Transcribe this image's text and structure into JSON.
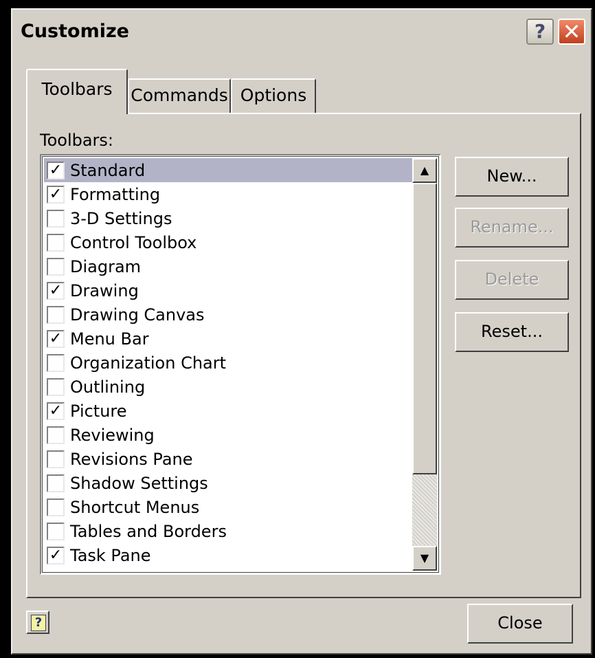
{
  "window": {
    "title": "Customize",
    "help_glyph": "?",
    "close_glyph": "✕"
  },
  "tabs": [
    {
      "label": "Toolbars",
      "active": true
    },
    {
      "label": "Commands",
      "active": false
    },
    {
      "label": "Options",
      "active": false
    }
  ],
  "toolbars_panel": {
    "label": "Toolbars:",
    "items": [
      {
        "label": "Standard",
        "checked": true,
        "selected": true
      },
      {
        "label": "Formatting",
        "checked": true
      },
      {
        "label": "3-D Settings",
        "checked": false
      },
      {
        "label": "Control Toolbox",
        "checked": false
      },
      {
        "label": "Diagram",
        "checked": false
      },
      {
        "label": "Drawing",
        "checked": true
      },
      {
        "label": "Drawing Canvas",
        "checked": false
      },
      {
        "label": "Menu Bar",
        "checked": true
      },
      {
        "label": "Organization Chart",
        "checked": false
      },
      {
        "label": "Outlining",
        "checked": false
      },
      {
        "label": "Picture",
        "checked": true
      },
      {
        "label": "Reviewing",
        "checked": false
      },
      {
        "label": "Revisions Pane",
        "checked": false
      },
      {
        "label": "Shadow Settings",
        "checked": false
      },
      {
        "label": "Shortcut Menus",
        "checked": false
      },
      {
        "label": "Tables and Borders",
        "checked": false
      },
      {
        "label": "Task Pane",
        "checked": true
      }
    ],
    "scroll_up_glyph": "▲",
    "scroll_down_glyph": "▼"
  },
  "buttons": {
    "new": "New...",
    "rename": "Rename...",
    "delete": "Delete",
    "reset": "Reset...",
    "close": "Close"
  },
  "footer": {
    "help_glyph": "?"
  },
  "colors": {
    "dialog_face": "#d4d0c8",
    "selected_row": "#b3b3c8",
    "disabled_text": "#9a9a9a"
  }
}
